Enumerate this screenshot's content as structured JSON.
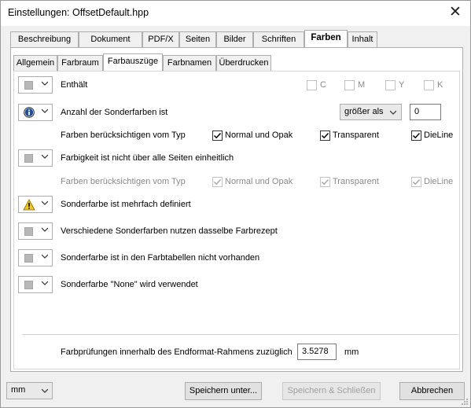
{
  "window": {
    "title": "Einstellungen:  OffsetDefault.hpp"
  },
  "outer_tabs": [
    "Beschreibung",
    "Dokument",
    "PDF/X",
    "Seiten",
    "Bilder",
    "Schriften",
    "Farben",
    "Inhalt"
  ],
  "outer_active": "Farben",
  "inner_tabs": [
    "Allgemein",
    "Farbraum",
    "Farbauszüge",
    "Farbnamen",
    "Überdrucken"
  ],
  "inner_active": "Farbauszüge",
  "checks": {
    "contains_label": "Enthält",
    "cmyk": [
      {
        "label": "C",
        "checked": false
      },
      {
        "label": "M",
        "checked": false
      },
      {
        "label": "Y",
        "checked": false
      },
      {
        "label": "K",
        "checked": false
      }
    ],
    "spot_count_label": "Anzahl der Sonderfarben ist",
    "comparison": "größer als",
    "spot_count_value": "0",
    "types_label": "Farben berücksichtigen vom Typ",
    "types": [
      {
        "label": "Normal und Opak",
        "checked": true
      },
      {
        "label": "Transparent",
        "checked": true
      },
      {
        "label": "DieLine",
        "checked": true
      }
    ],
    "inconsistent_label": "Farbigkeit ist nicht über alle Seiten einheitlich",
    "types2_label": "Farben berücksichtigen vom Typ",
    "types2": [
      {
        "label": "Normal und Opak",
        "checked": true
      },
      {
        "label": "Transparent",
        "checked": true
      },
      {
        "label": "DieLine",
        "checked": true
      }
    ],
    "multi_defined_label": "Sonderfarbe ist mehrfach definiert",
    "same_recipe_label": "Verschiedene Sonderfarben nutzen dasselbe Farbrezept",
    "not_in_tables_label": "Sonderfarbe ist in den Farbtabellen nicht vorhanden",
    "none_used_label": "Sonderfarbe \"None\" wird verwendet"
  },
  "bleed": {
    "label": "Farbprüfungen innerhalb des Endformat-Rahmens zuzüglich",
    "value": "3.5278",
    "unit": "mm"
  },
  "footer": {
    "unit_select": "mm",
    "save_as": "Speichern unter...",
    "save_close": "Speichern & Schließen",
    "cancel": "Abbrechen"
  },
  "colors": {
    "warning": "#f5c518",
    "info_blue": "#1f4e9c"
  }
}
